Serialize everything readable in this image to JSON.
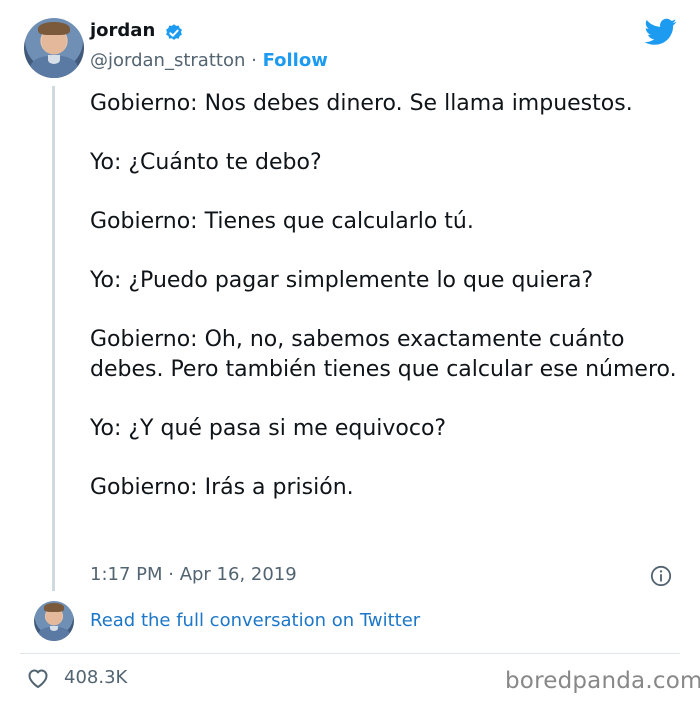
{
  "user": {
    "name": "jordan",
    "handle": "@jordan_stratton",
    "separator": "·",
    "follow_label": "Follow"
  },
  "tweet": {
    "paragraphs": [
      "Gobierno: Nos debes dinero. Se llama impuestos.",
      "Yo: ¿Cuánto te debo?",
      "Gobierno: Tienes que calcularlo tú.",
      "Yo: ¿Puedo pagar simplemente lo que quiera?",
      "Gobierno: Oh, no, sabemos exactamente cuánto debes. Pero también tienes que calcular ese número.",
      "Yo: ¿Y qué pasa si me equivoco?",
      "Gobierno: Irás a prisión."
    ],
    "timestamp": "1:17 PM · Apr 16, 2019"
  },
  "read_full_label": "Read the full conversation on Twitter",
  "likes": "408.3K",
  "watermark": "boredpanda.com",
  "icons": {
    "verified": "verified-badge-icon",
    "bird": "twitter-bird-icon",
    "info": "info-icon",
    "heart": "heart-icon"
  },
  "colors": {
    "link": "#1d9bf0",
    "muted": "#536471",
    "text": "#0f1419"
  }
}
